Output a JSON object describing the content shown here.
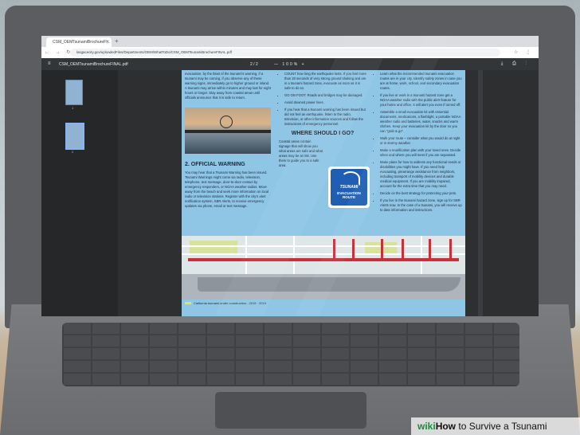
{
  "browser": {
    "tab_title": "CSM_OEMTsunamiBrochureFI...",
    "tab_close": "×",
    "new_tab": "+",
    "nav_buttons": "← → ↻",
    "url": "lasgacecity.gov/uploadedFiles/Departments/OEM/WhatToDo/CSM_OEMTsunamiBrochureFINAL.pdf",
    "addr_icons": "☆ ⋮"
  },
  "pdf_toolbar": {
    "menu_icon": "≡",
    "file_name": "CSM_OEMTsunamiBrochureFINAL.pdf",
    "page_indicator": "2 / 2",
    "zoom": "— 100% +",
    "tool_icons": "⤓ ⎙ ⋮"
  },
  "sidebar": {
    "thumb1_num": "1",
    "thumb2_num": "2"
  },
  "document": {
    "col1_intro": "evacuation, by the blast of the tsunami's warning, if a tsunami may be coming, if you observe any of these warning signs, immediately go to higher ground or inland. A tsunami may arrive within minutes and may last for eight hours or longer. Stay away from coastal areas until officials announce that it is safe to return.",
    "col1_heading": "2. OFFICIAL WARNING",
    "col1_body": "You may hear that a Tsunami Warning has been issued. Tsunami Warnings might come via radio, television, telephone, text message, door-to-door contact by emergency responders, or NOAA weather radios. Move away from the beach and seek more information on local radio or television stations. Register with the city's alert notification system, SBR Alerts, to receive emergency updates via phone, email or text message.",
    "col2_items": [
      "COUNT how long the earthquake lasts. If you feel more than 20 seconds of very strong ground shaking and are in a tsunami hazard zone, evacuate as soon as it is safe to do so.",
      "GO ON FOOT. Roads and bridges may be damaged.",
      "Avoid downed power lines.",
      "If you hear that a tsunami warning has been issued but did not feel an earthquake, listen to the radio, television, or other information sources and follow the instructions of emergency personnel."
    ],
    "col2_heading": "WHERE SHOULD I GO?",
    "col2_body": "Coastal areas contain signage that will show you what areas are safe and what areas may be at risk. Use them to guide you to a safe area.",
    "sign_line1": "TSUNAMI",
    "sign_line2": "EVACUATION ROUTE",
    "col3_items": [
      "Learn what the recommended tsunami evacuation routes are in your city. Identify safety zones in case you are at home, work, school, and secondary evacuation routes.",
      "If you live or work in a tsunami hazard zone get a NOAA weather radio with the public alert feature for your home and office. It will alert you even if turned off.",
      "Assemble a small evacuation kit with essential documents, medications, a flashlight, a portable NOAA weather radio and batteries, water, snacks and warm clothes. Keep your evacuation kit by the door so you can \"grab & go\".",
      "Walk your route – consider what you would do at night or in stormy weather.",
      "Make a reunification plan with your loved ones. Decide when and where you will meet if you are separated.",
      "Make plans for how to address any functional needs or disabilities you might have. If you need help evacuating, prearrange assistance from neighbors, including transport of mobility devices and durable medical equipment. If you are mobility impaired, account for the extra time that you may need.",
      "Decide on the best strategy for protecting your pets.",
      "If you live in the tsunami hazard zone, sign up for SBR Alerts now. In the case of a tsunami, you will receive up to date information and instructions."
    ],
    "map_legend": "California tsunami under construction - 2015 · 2019"
  },
  "caption": {
    "wiki": "wiki",
    "how": "How",
    "rest": " to Survive a Tsunami"
  }
}
